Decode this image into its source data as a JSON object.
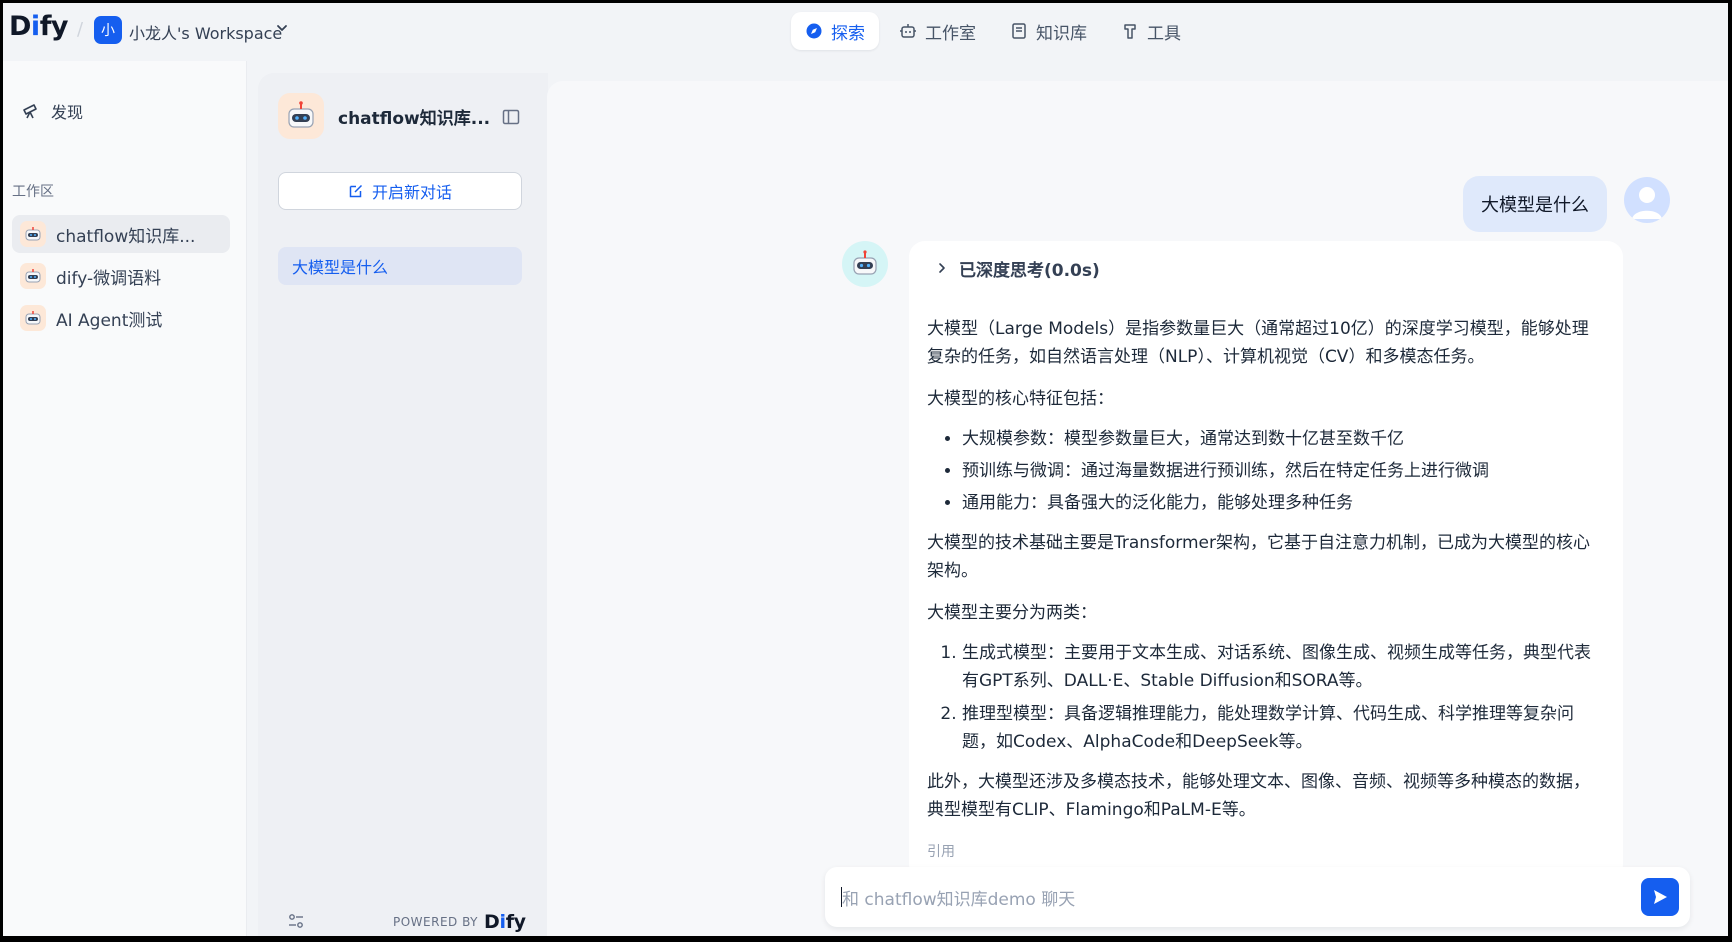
{
  "topbar": {
    "logo_left": "D",
    "logo_i": "i",
    "logo_right": "fy",
    "workspace_avatar": "小",
    "workspace_name": "小龙人's Workspace",
    "nav": [
      {
        "label": "探索",
        "icon": "compass-icon",
        "active": true
      },
      {
        "label": "工作室",
        "icon": "robot-icon",
        "active": false
      },
      {
        "label": "知识库",
        "icon": "book-icon",
        "active": false
      },
      {
        "label": "工具",
        "icon": "hammer-icon",
        "active": false
      }
    ]
  },
  "sidebar": {
    "discover_label": "发现",
    "workspace_label": "工作区",
    "apps": [
      {
        "label": "chatflow知识库...",
        "active": true
      },
      {
        "label": "dify-微调语料",
        "active": false
      },
      {
        "label": "AI Agent测试",
        "active": false
      }
    ]
  },
  "panel": {
    "app_title": "chatflow知识库...",
    "new_chat_label": "开启新对话",
    "conversations": [
      "大模型是什么"
    ],
    "powered_by": "POWERED BY",
    "powered_logo_left": "D",
    "powered_logo_i": "i",
    "powered_logo_right": "fy"
  },
  "chat": {
    "user_message": "大模型是什么",
    "thinking_label": "已深度思考(0.0s)",
    "answer": {
      "p1": "大模型（Large Models）是指参数量巨大（通常超过10亿）的深度学习模型，能够处理复杂的任务，如自然语言处理（NLP）、计算机视觉（CV）和多模态任务。",
      "p2": "大模型的核心特征包括：",
      "bullets": [
        "大规模参数：模型参数量巨大，通常达到数十亿甚至数千亿",
        "预训练与微调：通过海量数据进行预训练，然后在特定任务上进行微调",
        "通用能力：具备强大的泛化能力，能够处理多种任务"
      ],
      "p3": "大模型的技术基础主要是Transformer架构，它基于自注意力机制，已成为大模型的核心架构。",
      "p4": "大模型主要分为两类：",
      "numbered": [
        "生成式模型：主要用于文本生成、对话系统、图像生成、视频生成等任务，典型代表有GPT系列、DALL·E、Stable Diffusion和SORA等。",
        "推理型模型：具备逻辑推理能力，能处理数学计算、代码生成、科学推理等复杂问题，如Codex、AlphaCode和DeepSeek等。"
      ],
      "p5": "此外，大模型还涉及多模态技术，能够处理文本、图像、音频、视频等多种模态的数据，典型模型有CLIP、Flamingo和PaLM-E等。",
      "cut_off": "引用"
    },
    "input_placeholder": "和 chatflow知识库demo 聊天"
  },
  "colors": {
    "accent": "#155eef",
    "user_bubble": "#dfe9fb",
    "active_conversation": "#dfe5f4"
  }
}
